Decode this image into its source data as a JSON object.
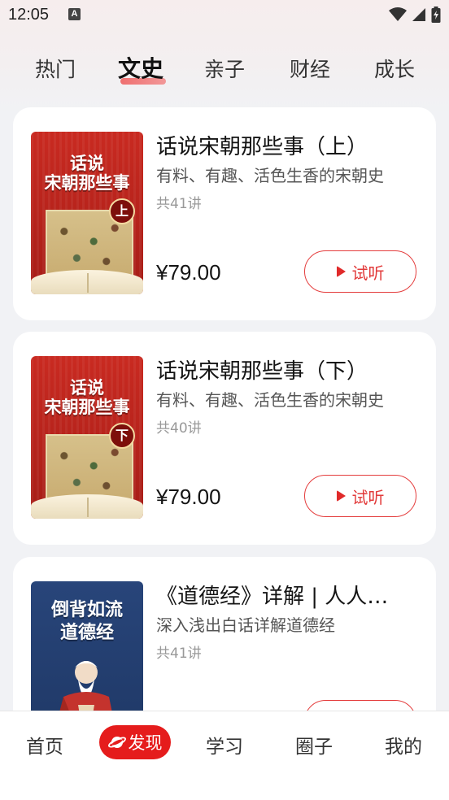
{
  "status_bar": {
    "time": "12:05",
    "notification_icon_letter": "A",
    "icons": [
      "wifi-icon",
      "cellular-signal-icon",
      "battery-charging-icon"
    ]
  },
  "tabs": [
    {
      "label": "热门",
      "active": false
    },
    {
      "label": "文史",
      "active": true
    },
    {
      "label": "亲子",
      "active": false
    },
    {
      "label": "财经",
      "active": false
    },
    {
      "label": "成长",
      "active": false
    }
  ],
  "items": [
    {
      "cover_line1": "话说",
      "cover_line2": "宋朝那些事",
      "cover_badge": "上",
      "title": "话说宋朝那些事（上）",
      "subtitle": "有料、有趣、活色生香的宋朝史",
      "count": "共41讲",
      "price": "¥79.00",
      "button": "试听"
    },
    {
      "cover_line1": "话说",
      "cover_line2": "宋朝那些事",
      "cover_badge": "下",
      "title": "话说宋朝那些事（下）",
      "subtitle": "有料、有趣、活色生香的宋朝史",
      "count": "共40讲",
      "price": "¥79.00",
      "button": "试听"
    },
    {
      "cover_line1": "倒背如流",
      "cover_line2": "道德经",
      "title": "《道德经》详解 | 人人…",
      "subtitle": "深入浅出白话详解道德经",
      "count": "共41讲"
    }
  ],
  "bottom_nav": [
    {
      "label": "首页",
      "active": false
    },
    {
      "label": "发现",
      "active": true,
      "icon": "planet-icon"
    },
    {
      "label": "学习",
      "active": false
    },
    {
      "label": "圈子",
      "active": false
    },
    {
      "label": "我的",
      "active": false
    }
  ],
  "colors": {
    "accent": "#e51c1c",
    "page_bg": "#f1f2f5",
    "card_bg": "#ffffff"
  }
}
